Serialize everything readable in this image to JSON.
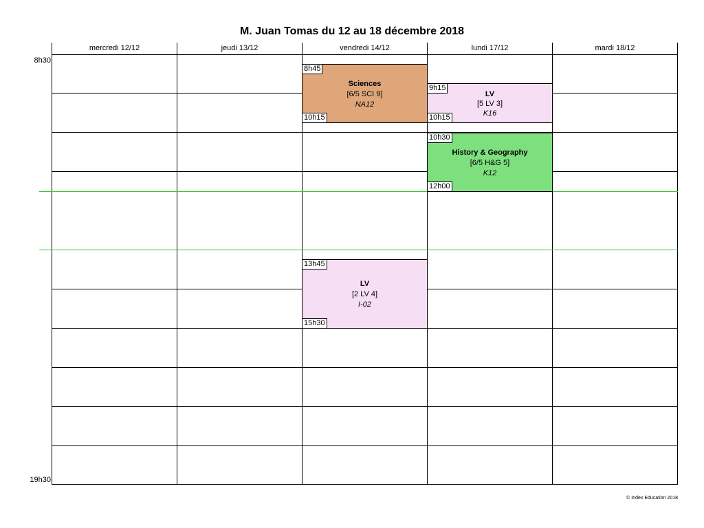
{
  "title": "M. Juan Tomas du 12 au 18 décembre 2018",
  "days": [
    "mercredi 12/12",
    "jeudi 13/12",
    "vendredi 14/12",
    "lundi 17/12",
    "mardi 18/12"
  ],
  "time_start": "8h30",
  "time_end": "19h30",
  "events": [
    {
      "subject": "Sciences",
      "group": "[6/5 SCI 9]",
      "room": "NA12",
      "start": "8h45",
      "end": "10h15",
      "color": "#dfa679"
    },
    {
      "subject": "LV",
      "group": "[5 LV 3]",
      "room": "K16",
      "start": "9h15",
      "end": "10h15",
      "color": "#f6dff5"
    },
    {
      "subject": "History & Geography",
      "group": "[6/5 H&G 5]",
      "room": "K12",
      "start": "10h30",
      "end": "12h00",
      "color": "#7ddf7d"
    },
    {
      "subject": "LV",
      "group": "[2 LV 4]",
      "room": "I-02",
      "start": "13h45",
      "end": "15h30",
      "color": "#f6dff5"
    }
  ],
  "footer": "© Index Education 2018"
}
